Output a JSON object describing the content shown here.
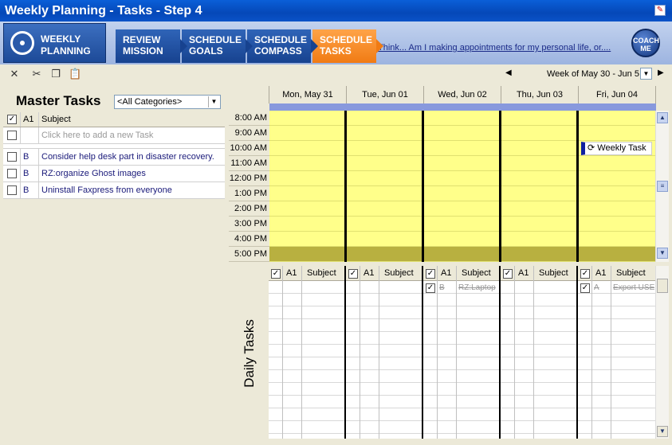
{
  "window": {
    "title": "Weekly Planning - Tasks - Step 4"
  },
  "banner": {
    "logo_line1": "WEEKLY",
    "logo_line2": "PLANNING",
    "steps": [
      {
        "line1": "REVIEW",
        "line2": "MISSION",
        "active": false
      },
      {
        "line1": "SCHEDULE",
        "line2": "GOALS",
        "active": false
      },
      {
        "line1": "SCHEDULE",
        "line2": "COMPASS",
        "active": false
      },
      {
        "line1": "SCHEDULE",
        "line2": "TASKS",
        "active": true
      }
    ],
    "think_link": "Think... Am I making appointments for my personal life, or....",
    "coach_line1": "COACH",
    "coach_line2": "ME"
  },
  "toolbar": {
    "icons": [
      "delete-icon",
      "cut-icon",
      "copy-icon",
      "paste-icon"
    ],
    "week_label": "Week of May 30 - Jun 5"
  },
  "master_tasks": {
    "title": "Master Tasks",
    "category": "<All Categories>",
    "col_priority": "A1",
    "col_subject": "Subject",
    "add_placeholder": "Click here to add a new Task",
    "tasks": [
      {
        "priority": "B",
        "subject": "Consider help desk part in disaster recovery."
      },
      {
        "priority": "B",
        "subject": "RZ:organize Ghost images"
      },
      {
        "priority": "B",
        "subject": "Uninstall Faxpress from everyone"
      }
    ]
  },
  "calendar": {
    "days": [
      "Mon, May 31",
      "Tue, Jun 01",
      "Wed, Jun 02",
      "Thu, Jun 03",
      "Fri, Jun 04"
    ],
    "times": [
      "8:00 AM",
      "9:00 AM",
      "10:00 AM",
      "11:00 AM",
      "12:00 PM",
      "1:00 PM",
      "2:00 PM",
      "3:00 PM",
      "4:00 PM",
      "5:00 PM"
    ],
    "appointment": "Weekly Task",
    "slot_color": "#ffff8a",
    "after_hours_color": "#b8b040"
  },
  "daily_tasks": {
    "title": "Daily Tasks",
    "col_priority": "A1",
    "col_subject": "Subject",
    "entries": [
      {
        "day": 2,
        "priority": "B",
        "subject": "RZ:Laptop"
      },
      {
        "day": 4,
        "priority": "A",
        "subject": "Export USE"
      }
    ]
  }
}
